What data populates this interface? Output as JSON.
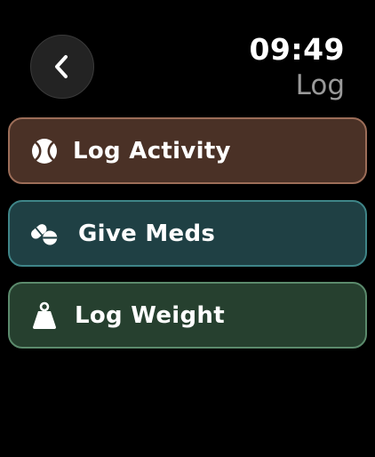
{
  "header": {
    "back_icon": "chevron-left-icon",
    "time": "09:49",
    "title": "Log"
  },
  "menu": {
    "items": [
      {
        "label": "Log Activity",
        "icon": "tennis-ball-icon",
        "background": "#4a3126",
        "border": "#9c6d58"
      },
      {
        "label": "Give Meds",
        "icon": "pills-icon",
        "background": "#1f4044",
        "border": "#3f8588"
      },
      {
        "label": "Log Weight",
        "icon": "weight-icon",
        "background": "#26402f",
        "border": "#5b8a6c"
      }
    ]
  }
}
